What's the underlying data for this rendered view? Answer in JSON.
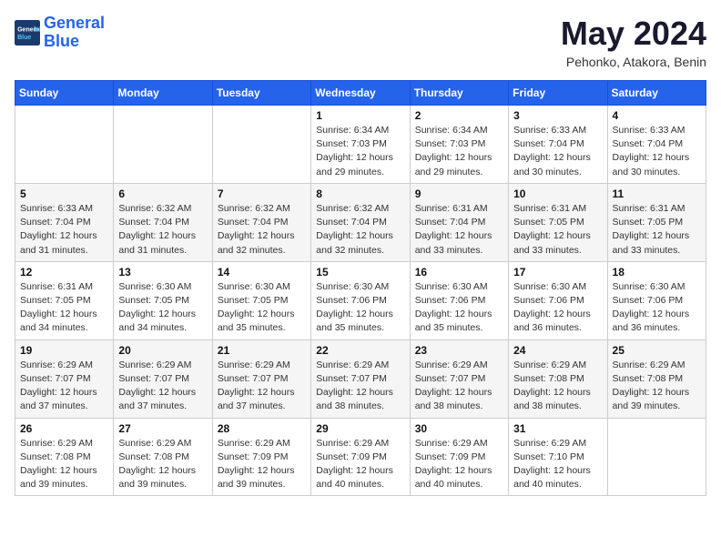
{
  "logo": {
    "line1": "General",
    "line2": "Blue"
  },
  "title": "May 2024",
  "location": "Pehonko, Atakora, Benin",
  "days_of_week": [
    "Sunday",
    "Monday",
    "Tuesday",
    "Wednesday",
    "Thursday",
    "Friday",
    "Saturday"
  ],
  "weeks": [
    [
      {
        "num": "",
        "sunrise": "",
        "sunset": "",
        "daylight": ""
      },
      {
        "num": "",
        "sunrise": "",
        "sunset": "",
        "daylight": ""
      },
      {
        "num": "",
        "sunrise": "",
        "sunset": "",
        "daylight": ""
      },
      {
        "num": "1",
        "sunrise": "Sunrise: 6:34 AM",
        "sunset": "Sunset: 7:03 PM",
        "daylight": "Daylight: 12 hours and 29 minutes."
      },
      {
        "num": "2",
        "sunrise": "Sunrise: 6:34 AM",
        "sunset": "Sunset: 7:03 PM",
        "daylight": "Daylight: 12 hours and 29 minutes."
      },
      {
        "num": "3",
        "sunrise": "Sunrise: 6:33 AM",
        "sunset": "Sunset: 7:04 PM",
        "daylight": "Daylight: 12 hours and 30 minutes."
      },
      {
        "num": "4",
        "sunrise": "Sunrise: 6:33 AM",
        "sunset": "Sunset: 7:04 PM",
        "daylight": "Daylight: 12 hours and 30 minutes."
      }
    ],
    [
      {
        "num": "5",
        "sunrise": "Sunrise: 6:33 AM",
        "sunset": "Sunset: 7:04 PM",
        "daylight": "Daylight: 12 hours and 31 minutes."
      },
      {
        "num": "6",
        "sunrise": "Sunrise: 6:32 AM",
        "sunset": "Sunset: 7:04 PM",
        "daylight": "Daylight: 12 hours and 31 minutes."
      },
      {
        "num": "7",
        "sunrise": "Sunrise: 6:32 AM",
        "sunset": "Sunset: 7:04 PM",
        "daylight": "Daylight: 12 hours and 32 minutes."
      },
      {
        "num": "8",
        "sunrise": "Sunrise: 6:32 AM",
        "sunset": "Sunset: 7:04 PM",
        "daylight": "Daylight: 12 hours and 32 minutes."
      },
      {
        "num": "9",
        "sunrise": "Sunrise: 6:31 AM",
        "sunset": "Sunset: 7:04 PM",
        "daylight": "Daylight: 12 hours and 33 minutes."
      },
      {
        "num": "10",
        "sunrise": "Sunrise: 6:31 AM",
        "sunset": "Sunset: 7:05 PM",
        "daylight": "Daylight: 12 hours and 33 minutes."
      },
      {
        "num": "11",
        "sunrise": "Sunrise: 6:31 AM",
        "sunset": "Sunset: 7:05 PM",
        "daylight": "Daylight: 12 hours and 33 minutes."
      }
    ],
    [
      {
        "num": "12",
        "sunrise": "Sunrise: 6:31 AM",
        "sunset": "Sunset: 7:05 PM",
        "daylight": "Daylight: 12 hours and 34 minutes."
      },
      {
        "num": "13",
        "sunrise": "Sunrise: 6:30 AM",
        "sunset": "Sunset: 7:05 PM",
        "daylight": "Daylight: 12 hours and 34 minutes."
      },
      {
        "num": "14",
        "sunrise": "Sunrise: 6:30 AM",
        "sunset": "Sunset: 7:05 PM",
        "daylight": "Daylight: 12 hours and 35 minutes."
      },
      {
        "num": "15",
        "sunrise": "Sunrise: 6:30 AM",
        "sunset": "Sunset: 7:06 PM",
        "daylight": "Daylight: 12 hours and 35 minutes."
      },
      {
        "num": "16",
        "sunrise": "Sunrise: 6:30 AM",
        "sunset": "Sunset: 7:06 PM",
        "daylight": "Daylight: 12 hours and 35 minutes."
      },
      {
        "num": "17",
        "sunrise": "Sunrise: 6:30 AM",
        "sunset": "Sunset: 7:06 PM",
        "daylight": "Daylight: 12 hours and 36 minutes."
      },
      {
        "num": "18",
        "sunrise": "Sunrise: 6:30 AM",
        "sunset": "Sunset: 7:06 PM",
        "daylight": "Daylight: 12 hours and 36 minutes."
      }
    ],
    [
      {
        "num": "19",
        "sunrise": "Sunrise: 6:29 AM",
        "sunset": "Sunset: 7:07 PM",
        "daylight": "Daylight: 12 hours and 37 minutes."
      },
      {
        "num": "20",
        "sunrise": "Sunrise: 6:29 AM",
        "sunset": "Sunset: 7:07 PM",
        "daylight": "Daylight: 12 hours and 37 minutes."
      },
      {
        "num": "21",
        "sunrise": "Sunrise: 6:29 AM",
        "sunset": "Sunset: 7:07 PM",
        "daylight": "Daylight: 12 hours and 37 minutes."
      },
      {
        "num": "22",
        "sunrise": "Sunrise: 6:29 AM",
        "sunset": "Sunset: 7:07 PM",
        "daylight": "Daylight: 12 hours and 38 minutes."
      },
      {
        "num": "23",
        "sunrise": "Sunrise: 6:29 AM",
        "sunset": "Sunset: 7:07 PM",
        "daylight": "Daylight: 12 hours and 38 minutes."
      },
      {
        "num": "24",
        "sunrise": "Sunrise: 6:29 AM",
        "sunset": "Sunset: 7:08 PM",
        "daylight": "Daylight: 12 hours and 38 minutes."
      },
      {
        "num": "25",
        "sunrise": "Sunrise: 6:29 AM",
        "sunset": "Sunset: 7:08 PM",
        "daylight": "Daylight: 12 hours and 39 minutes."
      }
    ],
    [
      {
        "num": "26",
        "sunrise": "Sunrise: 6:29 AM",
        "sunset": "Sunset: 7:08 PM",
        "daylight": "Daylight: 12 hours and 39 minutes."
      },
      {
        "num": "27",
        "sunrise": "Sunrise: 6:29 AM",
        "sunset": "Sunset: 7:08 PM",
        "daylight": "Daylight: 12 hours and 39 minutes."
      },
      {
        "num": "28",
        "sunrise": "Sunrise: 6:29 AM",
        "sunset": "Sunset: 7:09 PM",
        "daylight": "Daylight: 12 hours and 39 minutes."
      },
      {
        "num": "29",
        "sunrise": "Sunrise: 6:29 AM",
        "sunset": "Sunset: 7:09 PM",
        "daylight": "Daylight: 12 hours and 40 minutes."
      },
      {
        "num": "30",
        "sunrise": "Sunrise: 6:29 AM",
        "sunset": "Sunset: 7:09 PM",
        "daylight": "Daylight: 12 hours and 40 minutes."
      },
      {
        "num": "31",
        "sunrise": "Sunrise: 6:29 AM",
        "sunset": "Sunset: 7:10 PM",
        "daylight": "Daylight: 12 hours and 40 minutes."
      },
      {
        "num": "",
        "sunrise": "",
        "sunset": "",
        "daylight": ""
      }
    ]
  ]
}
